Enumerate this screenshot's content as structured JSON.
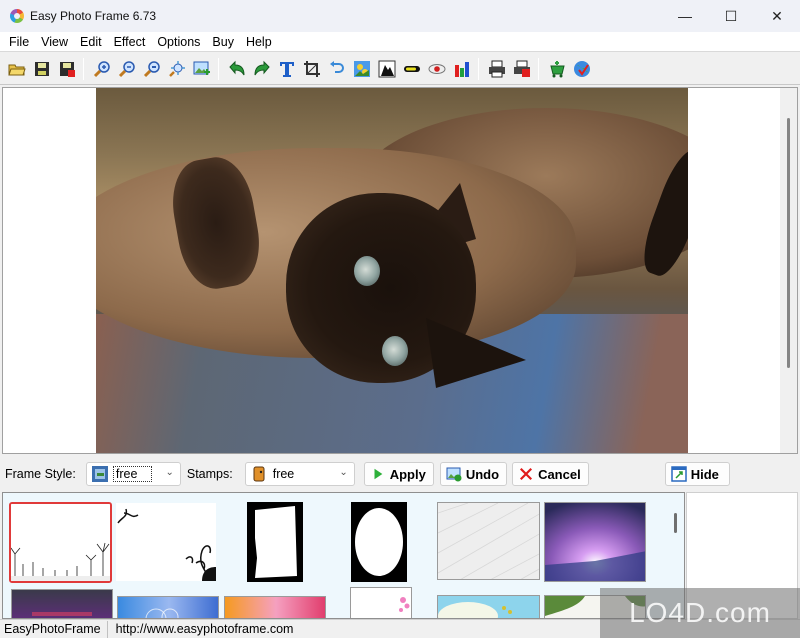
{
  "window": {
    "title": "Easy Photo Frame 6.73",
    "controls": {
      "minimize": "—",
      "maximize": "☐",
      "close": "✕"
    }
  },
  "menu": [
    "File",
    "View",
    "Edit",
    "Effect",
    "Options",
    "Buy",
    "Help"
  ],
  "toolbar": {
    "groups": [
      [
        "open-icon",
        "save-icon",
        "save-as-icon"
      ],
      [
        "zoom-in-icon",
        "zoom-out-icon",
        "zoom-fit-icon",
        "zoom-actual-icon",
        "insert-image-icon"
      ],
      [
        "undo-icon",
        "redo-icon",
        "text-icon",
        "crop-icon",
        "rotate-icon",
        "adjust-image-icon",
        "levels-icon",
        "brightness-icon",
        "red-eye-icon",
        "histogram-icon"
      ],
      [
        "print-icon",
        "print-setup-icon"
      ],
      [
        "buy-cart-icon",
        "web-icon"
      ]
    ]
  },
  "canvas": {
    "image_subject": "Siamese cat lying on rug"
  },
  "frame_bar": {
    "frame_style_label": "Frame Style:",
    "frame_style_value": "free",
    "stamps_label": "Stamps:",
    "stamps_value": "free",
    "apply_label": "Apply",
    "undo_label": "Undo",
    "cancel_label": "Cancel",
    "hide_label": "Hide"
  },
  "gallery": {
    "thumbnails": [
      {
        "name": "dandelion-frame",
        "selected": true
      },
      {
        "name": "swirl-frame",
        "selected": false
      },
      {
        "name": "torn-edge-frame",
        "selected": false
      },
      {
        "name": "cloud-mask-frame",
        "selected": false
      },
      {
        "name": "gray-texture-frame",
        "selected": false
      },
      {
        "name": "purple-burst-frame",
        "selected": false
      },
      {
        "name": "purple-dark-frame",
        "selected": false
      },
      {
        "name": "blue-bubbles-frame",
        "selected": false
      },
      {
        "name": "orange-pink-frame",
        "selected": false
      },
      {
        "name": "pink-floral-frame",
        "selected": false
      },
      {
        "name": "sky-blue-frame",
        "selected": false
      },
      {
        "name": "green-leaves-frame",
        "selected": false
      }
    ]
  },
  "status": {
    "app_name": "EasyPhotoFrame",
    "url": "http://www.easyphotoframe.com"
  },
  "watermark": "LO4D.com"
}
